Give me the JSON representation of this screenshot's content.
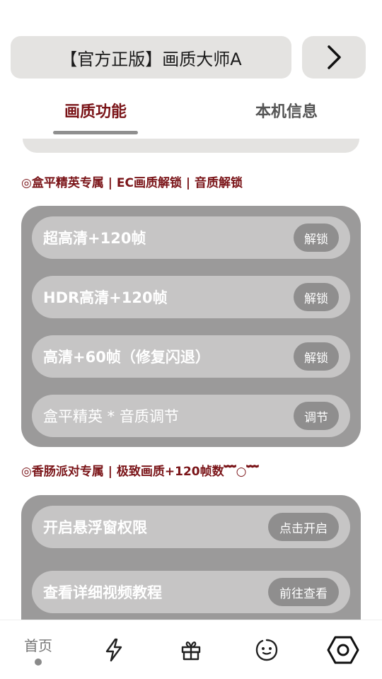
{
  "header": {
    "title": "【官方正版】画质大师A",
    "next_icon": "chevron-right-icon"
  },
  "tabs": [
    {
      "label": "画质功能",
      "active": true
    },
    {
      "label": "本机信息",
      "active": false
    }
  ],
  "sections": [
    {
      "heading": "◎盒平精英专属 | EC画质解锁 | 音质解锁",
      "rows": [
        {
          "label": "超高清+120帧",
          "action": "解锁"
        },
        {
          "label": "HDR高清+120帧",
          "action": "解锁"
        },
        {
          "label": "高清+60帧（修复闪退）",
          "action": "解锁"
        },
        {
          "label": "盒平精英 * 音质调节",
          "action": "调节"
        }
      ]
    },
    {
      "heading": "◎香肠派对专属 | 极致画质+120帧数﹌○﹌",
      "rows": [
        {
          "label": "开启悬浮窗权限",
          "action": "点击开启"
        },
        {
          "label": "查看详细视频教程",
          "action": "前往查看"
        }
      ]
    }
  ],
  "bottom_nav": {
    "home_label": "首页",
    "icons": [
      "lightning-icon",
      "gift-icon",
      "smiley-icon",
      "settings-hexagon-icon"
    ]
  },
  "colors": {
    "accent": "#7a1418",
    "panel": "#9b9a9a",
    "row": "#c6c5c5",
    "chip": "#8f8e8e",
    "pill": "#e4e3e1"
  }
}
